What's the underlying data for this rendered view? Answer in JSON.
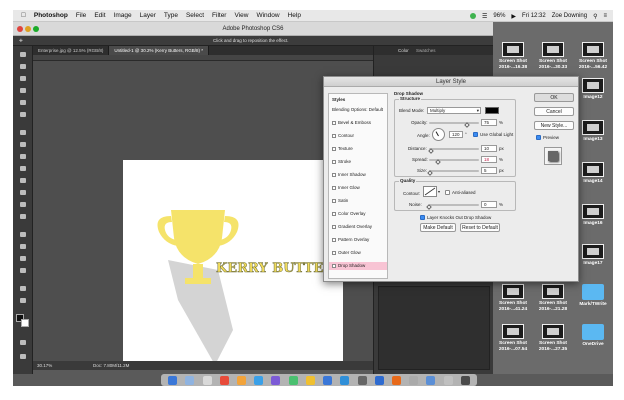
{
  "menubar": {
    "app_name": "Photoshop",
    "items": [
      "File",
      "Edit",
      "Image",
      "Layer",
      "Type",
      "Select",
      "Filter",
      "View",
      "Window",
      "Help"
    ],
    "battery": "96%",
    "time": "Fri 12:32",
    "user": "Zoe Downing"
  },
  "window": {
    "title": "Adobe Photoshop CS6",
    "hint": "Click and drag to reposition the effect."
  },
  "tabs": [
    {
      "label": "Enterprise.jpg @ 12.5% (RGB/8)"
    },
    {
      "label": "Untitled-1 @ 30.2% (Kerry Butters, RGB/8) *"
    }
  ],
  "canvas": {
    "text": "KERRY BUTTERS",
    "trophy_color": "#f5e36a",
    "shadow_color": "#cfcfcf"
  },
  "status": {
    "zoom": "30.17%",
    "doc": "Doc: 7.80M/11.2M"
  },
  "right_panels": {
    "tab_color": "Color",
    "tab_swatches": "Swatches"
  },
  "dialog": {
    "title": "Layer Style",
    "styles_header": "Styles",
    "styles": [
      {
        "label": "Blending Options: Default",
        "checkbox": false,
        "selected": false
      },
      {
        "label": "Bevel & Emboss",
        "checkbox": true,
        "selected": false
      },
      {
        "label": "Contour",
        "checkbox": true,
        "selected": false
      },
      {
        "label": "Texture",
        "checkbox": true,
        "selected": false
      },
      {
        "label": "Stroke",
        "checkbox": true,
        "selected": false
      },
      {
        "label": "Inner Shadow",
        "checkbox": true,
        "selected": false
      },
      {
        "label": "Inner Glow",
        "checkbox": true,
        "selected": false
      },
      {
        "label": "Satin",
        "checkbox": true,
        "selected": false
      },
      {
        "label": "Color Overlay",
        "checkbox": true,
        "selected": false
      },
      {
        "label": "Gradient Overlay",
        "checkbox": true,
        "selected": false
      },
      {
        "label": "Pattern Overlay",
        "checkbox": true,
        "selected": false
      },
      {
        "label": "Outer Glow",
        "checkbox": true,
        "selected": false
      },
      {
        "label": "Drop Shadow",
        "checkbox": true,
        "selected": true
      }
    ],
    "section_title": "Drop Shadow",
    "structure": {
      "label": "Structure",
      "blend_mode_label": "Blend Mode:",
      "blend_mode_value": "Multiply",
      "shadow_color": "#000000",
      "opacity_label": "Opacity:",
      "opacity_value": "75",
      "opacity_level": 0.75,
      "angle_label": "Angle:",
      "angle_value": "120",
      "use_global_light": "Use Global Light",
      "distance_label": "Distance:",
      "distance_value": "10",
      "distance_level": 0.04,
      "spread_label": "Spread:",
      "spread_value": "18",
      "spread_level": 0.18,
      "size_label": "Size:",
      "size_value": "5",
      "size_level": 0.02,
      "unit_percent": "%",
      "unit_px": "px",
      "unit_deg": "°"
    },
    "quality": {
      "label": "Quality",
      "contour_label": "Contour:",
      "anti_aliased": "Anti-aliased",
      "noise_label": "Noise:",
      "noise_value": "0",
      "noise_level": 0
    },
    "knocks_out": "Layer Knocks Out Drop Shadow",
    "make_default": "Make Default",
    "reset_default": "Reset to Default",
    "buttons": {
      "ok": "OK",
      "cancel": "Cancel",
      "new_style": "New Style...",
      "preview": "Preview"
    }
  },
  "desktop": [
    {
      "label": "Screen Shot\n2016-...16.38",
      "kind": "shot"
    },
    {
      "label": "Screen Shot\n2016-...30.33",
      "kind": "shot"
    },
    {
      "label": "Screen Shot\n2016-...56.42",
      "kind": "shot"
    },
    {
      "label": "Image12",
      "kind": "shot"
    },
    {
      "label": "Image13",
      "kind": "shot"
    },
    {
      "label": "Image14",
      "kind": "shot"
    },
    {
      "label": "Image16",
      "kind": "shot"
    },
    {
      "label": "Image17",
      "kind": "shot"
    },
    {
      "label": "Mark/TWrite",
      "kind": "folder"
    },
    {
      "label": "Screen Shot\n2016-...41.24",
      "kind": "shot"
    },
    {
      "label": "Screen Shot\n2016-...21.28",
      "kind": "shot"
    },
    {
      "label": "Screen Shot\n2016-...07.54",
      "kind": "shot"
    },
    {
      "label": "Screen Shot\n2016-...27.35",
      "kind": "shot"
    },
    {
      "label": "OneDrive",
      "kind": "folder"
    }
  ],
  "dock_colors": [
    "#3a77d8",
    "#8fb3e0",
    "#d9d9d9",
    "#e84b3a",
    "#f2a33a",
    "#3aa0e8",
    "#7c5bd6",
    "#4ac070",
    "#f0c030",
    "#3a77d8",
    "#2f8fd8",
    "#666666",
    "#2e6bd0",
    "#e86a1a",
    "#aaaaaa",
    "#5b8fd6",
    "#c0c0c0",
    "#4a4a4a"
  ]
}
